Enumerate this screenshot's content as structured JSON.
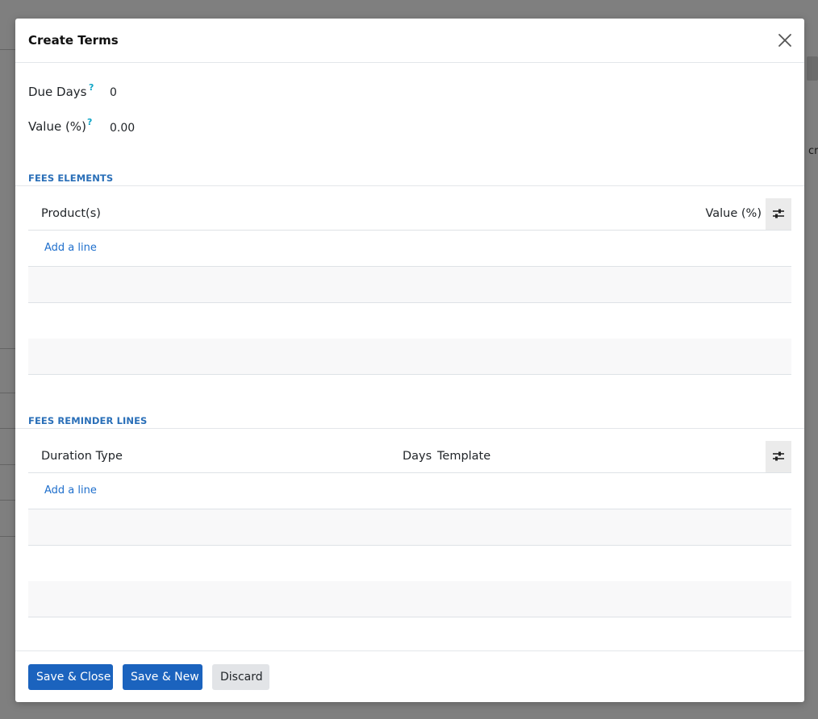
{
  "modal": {
    "title": "Create Terms"
  },
  "fields": {
    "due_days": {
      "label": "Due Days",
      "help": "?",
      "value": "0"
    },
    "value_percent": {
      "label": "Value (%)",
      "help": "?",
      "value": "0.00"
    }
  },
  "fees_elements": {
    "section_title": "FEES ELEMENTS",
    "columns": [
      "Product(s)",
      "Value (%)"
    ],
    "add_line": "Add a line"
  },
  "fees_reminder_lines": {
    "section_title": "FEES REMINDER LINES",
    "columns": [
      "Duration Type",
      "Days",
      "Template"
    ],
    "add_line": "Add a line"
  },
  "footer": {
    "save_close": "Save & Close",
    "save_new": "Save & New",
    "discard": "Discard"
  },
  "background": {
    "peek_text": "cr"
  },
  "colors": {
    "primary": "#1b63be",
    "section_title": "#2a6fb8",
    "help": "#0ea5c6",
    "link": "#1f6fcc",
    "backdrop": "#7f7f7f"
  },
  "icons": {
    "close": "close-icon",
    "column_settings": "sliders-icon"
  }
}
